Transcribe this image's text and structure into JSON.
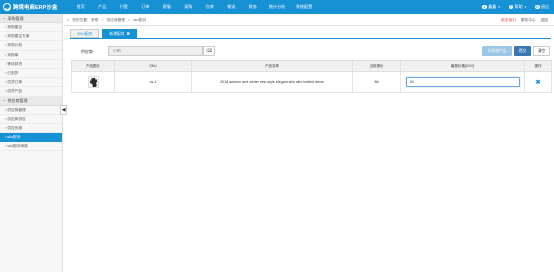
{
  "header": {
    "logo_text": "跨境电商ERP沙盒",
    "nav": [
      "首页",
      "产品",
      "刊登",
      "订单",
      "客服",
      "采购",
      "仓库",
      "物流",
      "财务",
      "统计分析",
      "系统配置"
    ],
    "user": "鑫鑫",
    "help": "帮助",
    "exit": "退出"
  },
  "sidebar": {
    "groups": [
      {
        "title": "采购管理",
        "items": [
          "采购建议",
          "采购建议方案",
          "采购计划",
          "采购单",
          "等待到货",
          "已到货",
          "供货订单",
          "供货产品"
        ]
      },
      {
        "title": "供应商管理",
        "items": [
          "供应商管理",
          "供应商供应",
          "供应优惠",
          "sku配对",
          "sku配对审核"
        ]
      }
    ],
    "active_item": "sku配对",
    "toggle_glyph": "◀"
  },
  "breadcrumb": {
    "items": [
      "您的位置:",
      "采购",
      "供应商管理",
      "sku配对"
    ],
    "links": [
      "新手指引",
      "服务中心",
      "返回"
    ]
  },
  "tabs": [
    {
      "label": "SKU配对",
      "active": false
    },
    {
      "label": "新增配对",
      "active": true,
      "close": "✖"
    }
  ],
  "form": {
    "store_label": "供应商",
    "required_mark": "*",
    "store_value": "小明",
    "clear_icon": "⌫"
  },
  "buttons": {
    "add_product": "添加产品",
    "save": "提交",
    "clear": "清空"
  },
  "table": {
    "columns": [
      "产品图片",
      "SKU",
      "产品名称",
      "当前报价",
      "最报价格[CNY]",
      "操作"
    ],
    "rows": [
      {
        "sku": "cs-1",
        "name": "2018 autumn and winter new style elegant slim slim knitted dress",
        "price": "88",
        "quote_value": "60",
        "delete_icon": "✖"
      }
    ]
  }
}
